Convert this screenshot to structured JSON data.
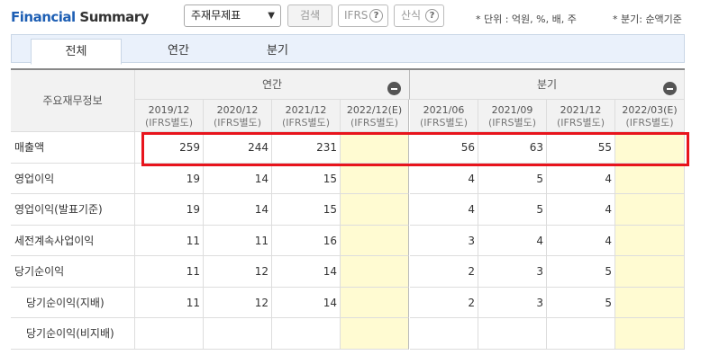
{
  "header": {
    "brand_part1": "Financial",
    "brand_part2": "Summary",
    "select_value": "주재무제표",
    "search_label": "검색",
    "ifrs_label": "IFRS",
    "calc_label": "산식",
    "help_glyph": "?",
    "unit_note": "* 단위 : 억원, %, 배, 주",
    "period_note": "* 분기: 순액기준"
  },
  "tabs": [
    "전체",
    "연간",
    "분기"
  ],
  "table": {
    "corner_label": "주요재무정보",
    "group_annual": "연간",
    "group_quarter": "분기",
    "columns": [
      {
        "period": "2019/12",
        "basis": "(IFRS별도)"
      },
      {
        "period": "2020/12",
        "basis": "(IFRS별도)"
      },
      {
        "period": "2021/12",
        "basis": "(IFRS별도)"
      },
      {
        "period": "2022/12(E)",
        "basis": "(IFRS별도)"
      },
      {
        "period": "2021/06",
        "basis": "(IFRS별도)"
      },
      {
        "period": "2021/09",
        "basis": "(IFRS별도)"
      },
      {
        "period": "2021/12",
        "basis": "(IFRS별도)"
      },
      {
        "period": "2022/03(E)",
        "basis": "(IFRS별도)"
      }
    ],
    "rows": [
      {
        "label": "매출액",
        "values": [
          "259",
          "244",
          "231",
          "",
          "56",
          "63",
          "55",
          ""
        ]
      },
      {
        "label": "영업이익",
        "values": [
          "19",
          "14",
          "15",
          "",
          "4",
          "5",
          "4",
          ""
        ]
      },
      {
        "label": "영업이익(발표기준)",
        "values": [
          "19",
          "14",
          "15",
          "",
          "4",
          "5",
          "4",
          ""
        ]
      },
      {
        "label": "세전계속사업이익",
        "values": [
          "11",
          "11",
          "16",
          "",
          "3",
          "4",
          "4",
          ""
        ]
      },
      {
        "label": "당기순이익",
        "values": [
          "11",
          "12",
          "14",
          "",
          "2",
          "3",
          "5",
          ""
        ]
      },
      {
        "label": "당기순이익(지배)",
        "values": [
          "11",
          "12",
          "14",
          "",
          "2",
          "3",
          "5",
          ""
        ]
      },
      {
        "label": "당기순이익(비지배)",
        "values": [
          "",
          "",
          "",
          "",
          "",
          "",
          "",
          ""
        ]
      }
    ]
  },
  "colors": {
    "brand_blue": "#1e5fb4",
    "estimate_fill": "#fffbd2",
    "highlight_red": "#e8141c"
  }
}
